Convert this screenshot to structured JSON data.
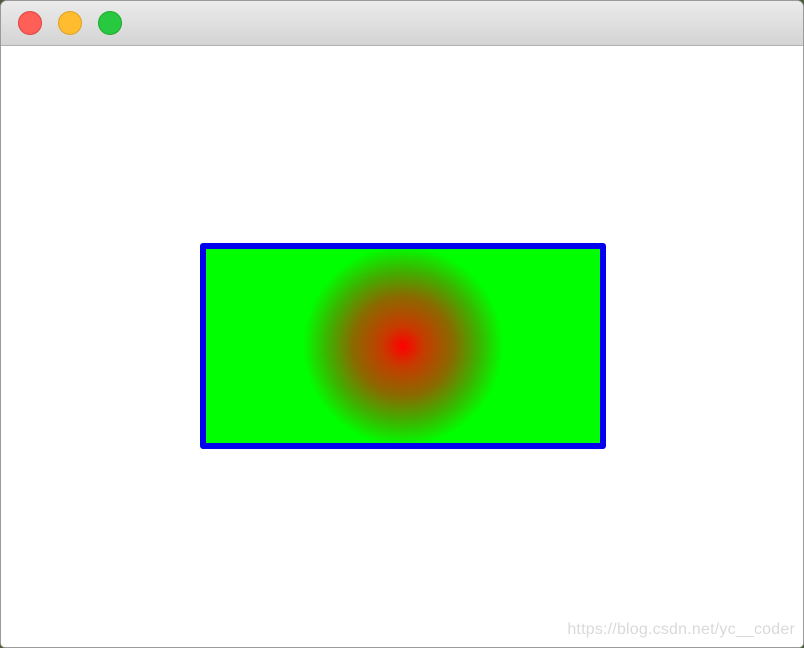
{
  "window": {
    "traffic_lights": [
      "close",
      "minimize",
      "zoom"
    ]
  },
  "canvas": {
    "shape": "rectangle",
    "stroke_color": "#0000ee",
    "fill_type": "radial-gradient",
    "gradient_center_color": "#ff0000",
    "gradient_outer_color": "#00ff00",
    "background_color": "#ffffff"
  },
  "watermark": {
    "text": "https://blog.csdn.net/yc__coder"
  }
}
